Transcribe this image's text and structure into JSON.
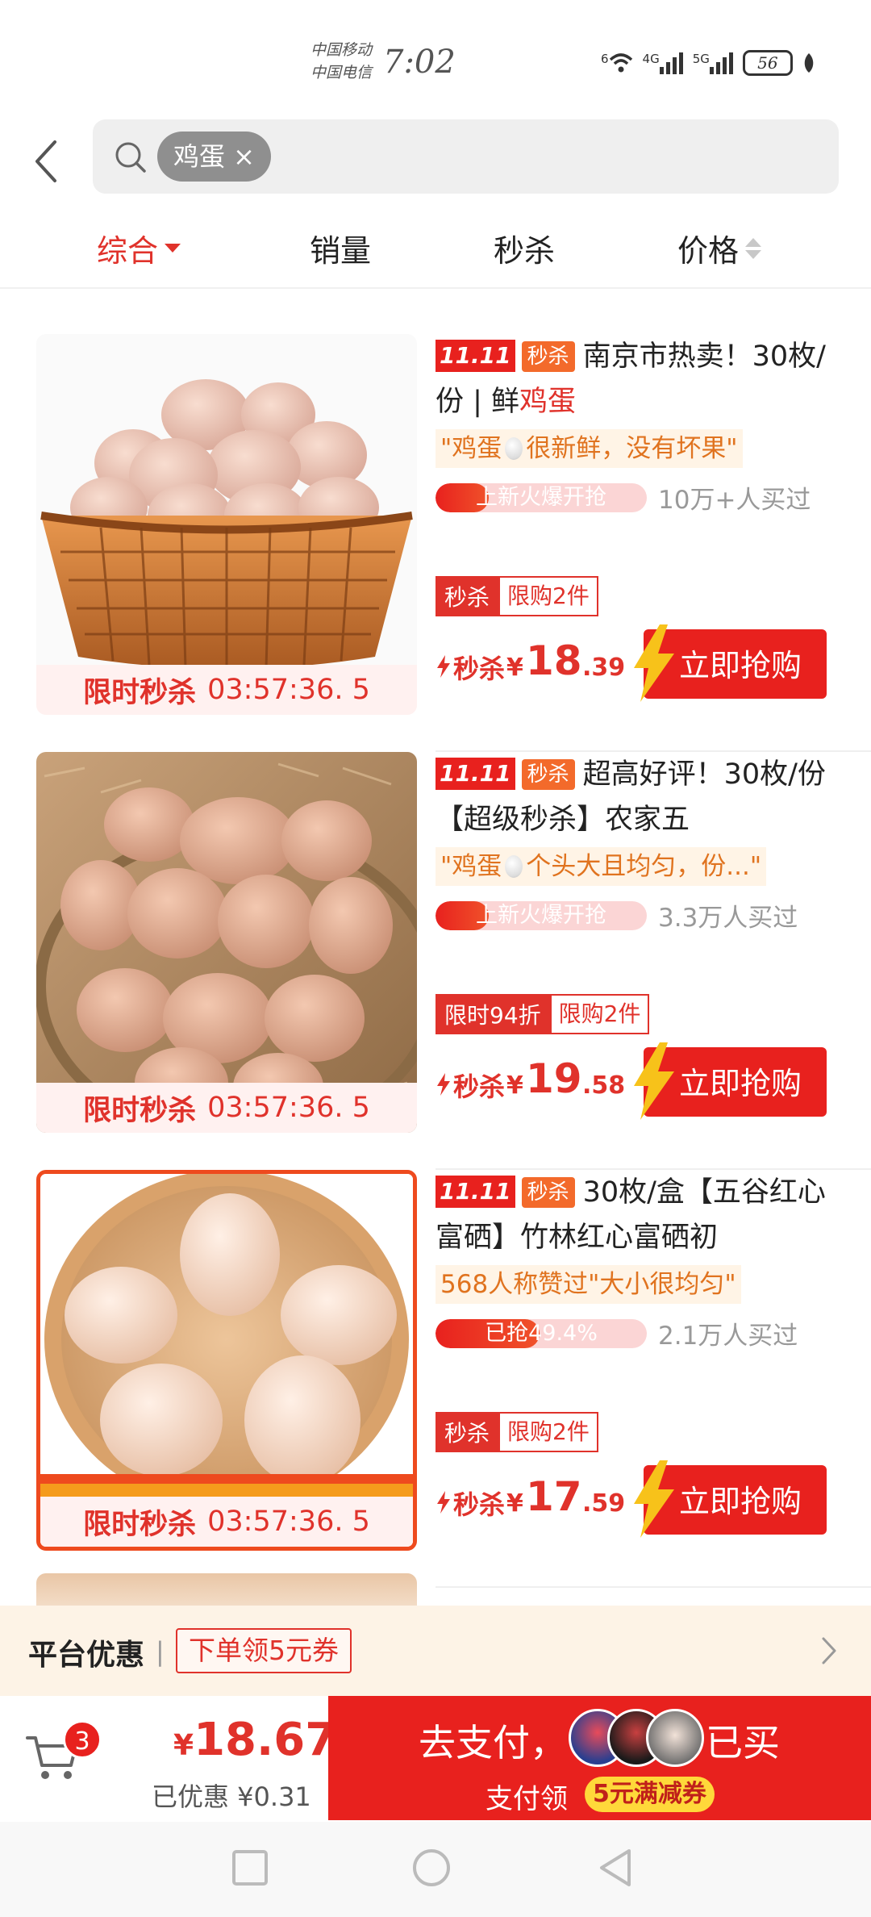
{
  "status_bar": {
    "carrier_1": "中国移动",
    "carrier_2": "中国电信",
    "time": "7:02",
    "net_1": "6",
    "net_2": "4G",
    "net_3": "5G",
    "battery": "56"
  },
  "search": {
    "query_chip": "鸡蛋 ×"
  },
  "sort_tabs": [
    {
      "label": "综合",
      "active": true
    },
    {
      "label": "销量",
      "active": false
    },
    {
      "label": "秒杀",
      "active": false
    },
    {
      "label": "价格",
      "active": false
    }
  ],
  "products": [
    {
      "tag_1111": "11.11",
      "tag_flash": "秒杀",
      "title_plain": "南京市热卖！30枚/份 | 鲜",
      "title_highlight": "鸡蛋",
      "title_rest": "",
      "review_pre": "\"鸡蛋",
      "review_post": "很新鲜，没有坏果\"",
      "progress_text": "上新火爆开抢",
      "progress_fraction": 0.25,
      "buyers": "10万+人买过",
      "promo_tag_1": "秒杀",
      "promo_tag_2": "限购2件",
      "price_label": "秒杀",
      "currency": "¥",
      "price_int": "18",
      "price_dec": ".39",
      "buy_label": "立即抢购",
      "timer_label": "限时秒杀",
      "timer_value": "03:57:36. 5"
    },
    {
      "tag_1111": "11.11",
      "tag_flash": "秒杀",
      "title_plain": "超高好评！30枚/份【超级秒杀】农家五",
      "title_highlight": "",
      "title_rest": "",
      "review_pre": "\"鸡蛋",
      "review_post": "个头大且均匀，份...\"",
      "progress_text": "上新火爆开抢",
      "progress_fraction": 0.25,
      "buyers": "3.3万人买过",
      "promo_tag_1": "限时94折",
      "promo_tag_2": "限购2件",
      "price_label": "秒杀",
      "currency": "¥",
      "price_int": "19",
      "price_dec": ".58",
      "buy_label": "立即抢购",
      "timer_label": "限时秒杀",
      "timer_value": "03:57:36. 5"
    },
    {
      "tag_1111": "11.11",
      "tag_flash": "秒杀",
      "title_plain": "30枚/盒【五谷红心富硒】竹林红心富硒初",
      "title_highlight": "",
      "title_rest": "",
      "review_pre": "568人称赞过\"大小很均匀\"",
      "review_post": "",
      "progress_text": "已抢49.4%",
      "progress_fraction": 0.494,
      "buyers": "2.1万人买过",
      "promo_tag_1": "秒杀",
      "promo_tag_2": "限购2件",
      "price_label": "秒杀",
      "currency": "¥",
      "price_int": "17",
      "price_dec": ".59",
      "buy_label": "立即抢购",
      "timer_label": "限时秒杀",
      "timer_value": "03:57:36. 5"
    }
  ],
  "promo_bar": {
    "title": "平台优惠",
    "separator": "|",
    "coupon": "下单领5元券"
  },
  "checkout": {
    "cart_count": "3",
    "currency": "¥",
    "total": "18.67",
    "saved": "已优惠 ¥0.31",
    "pay_label": "去支付，",
    "bought_label": "已买",
    "pay_sub": "支付领",
    "pay_coupon": "5元满减券"
  },
  "colors": {
    "accent": "#e0322b",
    "flash_orange": "#f36a2b",
    "review_bg": "#fff4e6",
    "promo_bg": "#fdf3e6"
  }
}
